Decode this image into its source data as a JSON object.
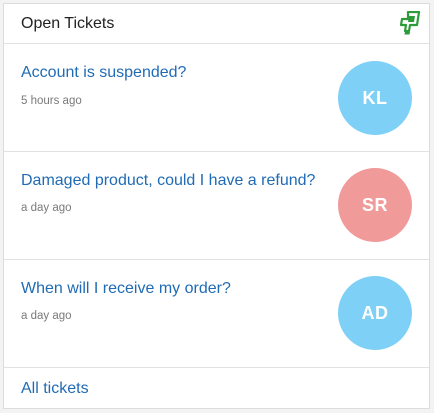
{
  "header": {
    "title": "Open Tickets",
    "logo_icon": "freshdesk-logo-icon",
    "logo_color": "#2e9b3a"
  },
  "tickets": [
    {
      "subject": "Account is suspended?",
      "time": "5 hours ago",
      "initials": "KL",
      "avatar_color": "#7fd0f7"
    },
    {
      "subject": "Damaged product, could I have a refund?",
      "time": "a day ago",
      "initials": "SR",
      "avatar_color": "#f09a9a"
    },
    {
      "subject": "When will I receive my order?",
      "time": "a day ago",
      "initials": "AD",
      "avatar_color": "#7fd0f7"
    }
  ],
  "footer": {
    "link_label": "All tickets"
  },
  "colors": {
    "link": "#1f6bb5",
    "muted_text": "#7a7a7a",
    "divider": "#e2e2e2"
  }
}
